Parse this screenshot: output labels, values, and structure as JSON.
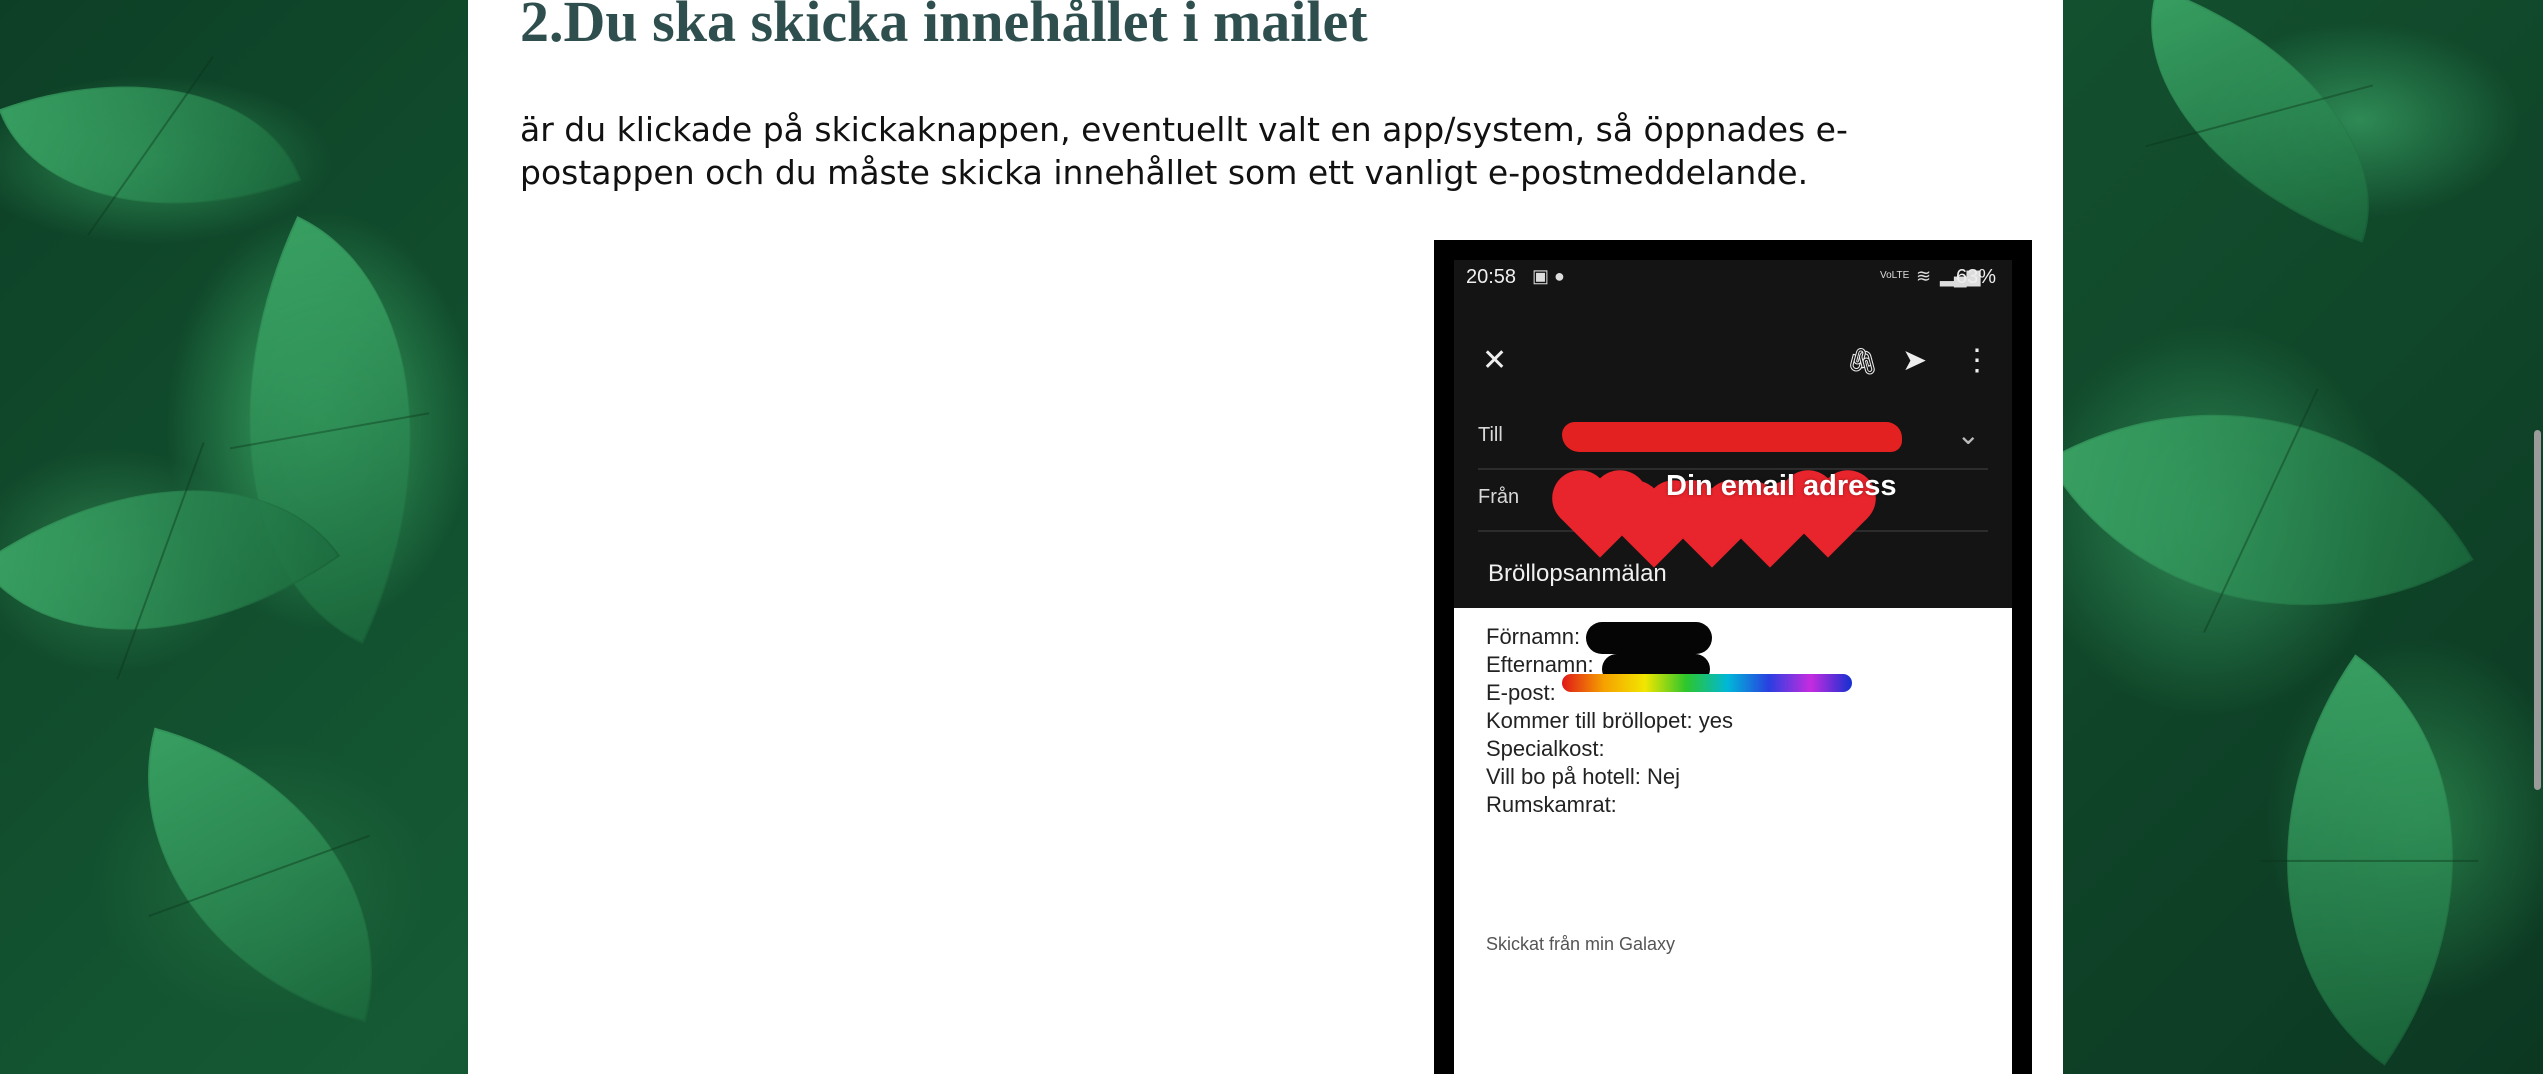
{
  "section": {
    "heading": "2.Du ska skicka innehållet i mailet",
    "paragraph": "är du klickade på skickaknappen, eventuellt valt en app/system, så öppnades e-postappen och du måste skicka innehållet som ett vanligt e-postmeddelande."
  },
  "phone": {
    "status": {
      "time": "20:58",
      "volte": "VoLTE",
      "battery": "63%"
    },
    "toolbar": {
      "close_icon": "close-icon",
      "attach_icon": "paperclip-icon",
      "send_icon": "send-icon",
      "more_icon": "more-vert-icon"
    },
    "to_label": "Till",
    "from_label": "Från",
    "from_overlay": "Din email adress",
    "subject": "Bröllopsanmälan",
    "body_lines": [
      "Förnamn:",
      "Efternamn:",
      "E-post:",
      "Kommer till bröllopet: yes",
      "Specialkost:",
      "Vill bo på hotell: Nej",
      "Rumskamrat:"
    ],
    "signature": "Skickat från min Galaxy"
  },
  "colors": {
    "heading": "#2f4f4f",
    "redaction_red": "#e32121",
    "hearts": "#e8242c"
  }
}
